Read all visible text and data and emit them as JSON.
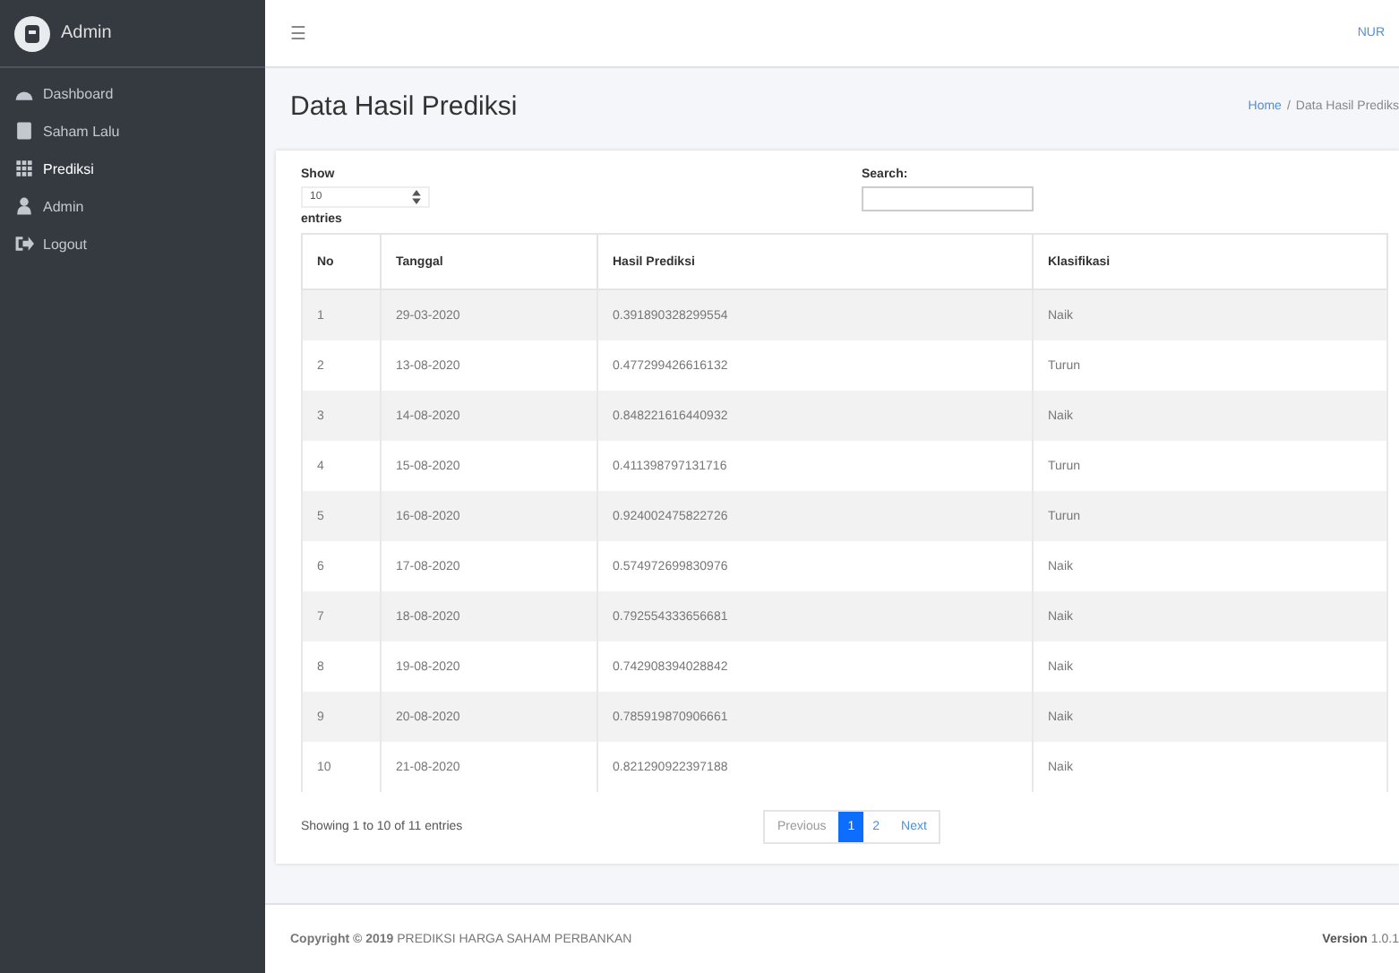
{
  "sidebar": {
    "brand": "Admin",
    "items": [
      {
        "label": "Dashboard",
        "kind": "dashboard",
        "selected": false
      },
      {
        "label": "Saham Lalu",
        "kind": "book",
        "selected": false
      },
      {
        "label": "Prediksi",
        "kind": "table",
        "selected": true
      },
      {
        "label": "Admin",
        "kind": "user",
        "selected": false
      },
      {
        "label": "Logout",
        "kind": "logout",
        "selected": false
      }
    ]
  },
  "navbar": {
    "menu_icon": "☰",
    "user": "NUR"
  },
  "header": {
    "title": "Data Hasil Prediksi",
    "breadcrumb": [
      {
        "label": "Home",
        "link": true
      },
      {
        "label": "Data Hasil Prediks",
        "link": false
      }
    ],
    "separator": "/"
  },
  "table_controls": {
    "show_label": "Show",
    "page_length": "10",
    "entries_label": "entries",
    "search_label": "Search:"
  },
  "table": {
    "columns": [
      "No",
      "Tanggal",
      "Hasil Prediksi",
      "Klasifikasi"
    ],
    "rows": [
      [
        "1",
        "29-03-2020",
        "0.391890328299554",
        "Naik"
      ],
      [
        "2",
        "13-08-2020",
        "0.477299426616132",
        "Turun"
      ],
      [
        "3",
        "14-08-2020",
        "0.848221616440932",
        "Naik"
      ],
      [
        "4",
        "15-08-2020",
        "0.411398797131716",
        "Turun"
      ],
      [
        "5",
        "16-08-2020",
        "0.924002475822726",
        "Turun"
      ],
      [
        "6",
        "17-08-2020",
        "0.574972699830976",
        "Naik"
      ],
      [
        "7",
        "18-08-2020",
        "0.792554333656681",
        "Naik"
      ],
      [
        "8",
        "19-08-2020",
        "0.742908394028842",
        "Naik"
      ],
      [
        "9",
        "20-08-2020",
        "0.785919870906661",
        "Naik"
      ],
      [
        "10",
        "21-08-2020",
        "0.821290922397188",
        "Naik"
      ]
    ]
  },
  "info": "Showing 1 to 10 of 11 entries",
  "pagination": [
    {
      "label": "Previous",
      "kind": "prev",
      "selected": false,
      "disabled": true
    },
    {
      "label": "1",
      "kind": "page",
      "selected": true,
      "disabled": false
    },
    {
      "label": "2",
      "kind": "page",
      "selected": false,
      "disabled": false
    },
    {
      "label": "Next",
      "kind": "next",
      "selected": false,
      "disabled": false
    }
  ],
  "footer": {
    "copyright": "**Copyright © 2019** PREDIKSI HARGA SAHAM PERBANKAN",
    "version_label": "Version",
    "version": "1.0.1"
  }
}
